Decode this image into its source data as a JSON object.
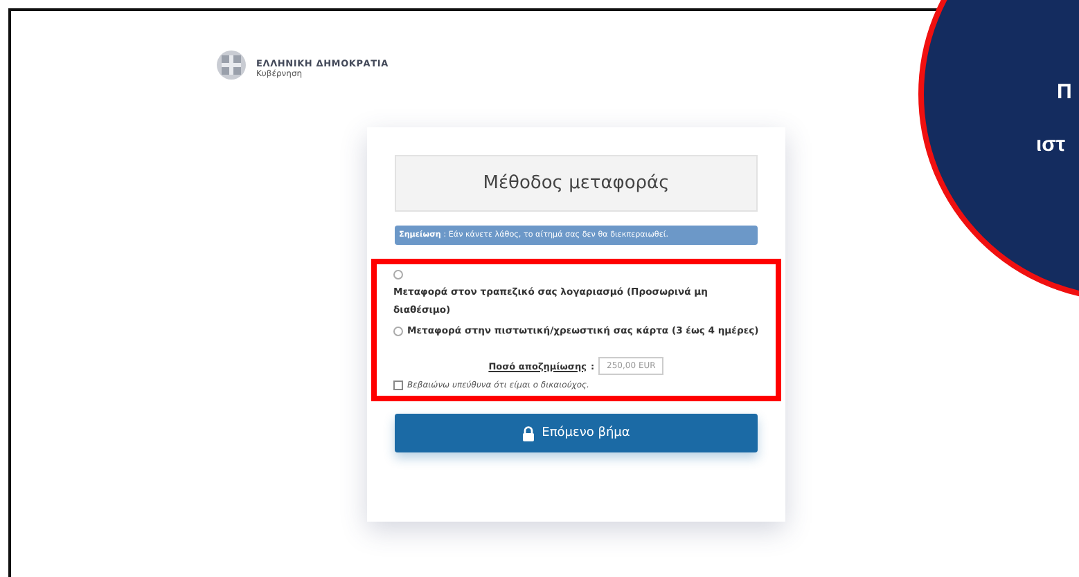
{
  "header": {
    "title": "ΕΛΛΗΝΙΚΗ ΔΗΜΟΚΡΑΤΙΑ",
    "subtitle": "Κυβέρνηση"
  },
  "card": {
    "title": "Μέθοδος μεταφοράς",
    "note": "**Σημείωση** : Εάν κάνετε λάθος, το αίτημά σας δεν θα διεκπεραιωθεί.",
    "options": [
      {
        "label": "Μεταφορά στον τραπεζικό σας λογαριασμό (Προσωρινά μη διαθέσιμο)",
        "selected": false
      },
      {
        "label": "Μεταφορά στην πιστωτική/χρεωστική σας κάρτα (3 έως 4 ημέρες)",
        "selected": false
      }
    ],
    "amount": {
      "label": "Ποσό αποζημίωσης",
      "separator": ":",
      "value": "250,00 EUR"
    },
    "confirm": {
      "label": "Βεβαιώνω υπεύθυνα ότι είμαι ο δικαιούχος.",
      "checked": false
    },
    "button": "Επόμενο βήμα"
  },
  "callout": {
    "lines": [
      "Π",
      "ιστ"
    ]
  }
}
